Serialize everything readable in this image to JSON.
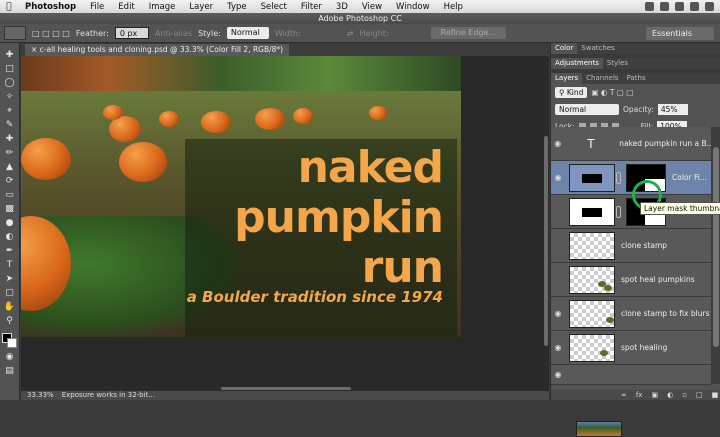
{
  "menubar": {
    "items": [
      "Photoshop",
      "File",
      "Edit",
      "Image",
      "Layer",
      "Type",
      "Select",
      "Filter",
      "3D",
      "View",
      "Window",
      "Help"
    ]
  },
  "window": {
    "title": "Adobe Photoshop CC"
  },
  "options": {
    "feather_label": "Feather:",
    "feather_value": "0 px",
    "antialias_label": "Anti-alias",
    "style_label": "Style:",
    "style_value": "Normal",
    "width_label": "Width:",
    "height_label": "Height:",
    "refine_edge": "Refine Edge...",
    "workspace": "Essentials"
  },
  "document": {
    "tab_title": "c-all healing tools and cloning.psd @ 33.3% (Color Fill 2, RGB/8*)",
    "headline": [
      "naked",
      "pumpkin",
      "run"
    ],
    "tagline": "a Boulder tradition since 1974"
  },
  "status": {
    "zoom": "33.33%",
    "message": "Exposure works in 32-bit..."
  },
  "panels": {
    "top_tabs": [
      "Color",
      "Swatches"
    ],
    "mid_tabs": [
      "Adjustments",
      "Styles"
    ],
    "layer_tabs": [
      "Layers",
      "Channels",
      "Paths"
    ],
    "kind": "Kind",
    "blend_mode": "Normal",
    "opacity_label": "Opacity:",
    "opacity_value": "45%",
    "lock_label": "Lock:",
    "fill_label": "Fill:",
    "fill_value": "100%"
  },
  "layers": [
    {
      "name": "naked pumpkin run a B...",
      "type": "text"
    },
    {
      "name": "Color Fi...",
      "type": "fill",
      "selected": true
    },
    {
      "name": "",
      "type": "fill"
    },
    {
      "name": "clone stamp",
      "type": "pixel"
    },
    {
      "name": "spot heal pumpkins",
      "type": "pixel"
    },
    {
      "name": "clone stamp to fix blurs",
      "type": "pixel"
    },
    {
      "name": "spot healing",
      "type": "pixel"
    },
    {
      "name": "",
      "type": "photo"
    }
  ],
  "tooltip": "Layer mask thumbnail"
}
